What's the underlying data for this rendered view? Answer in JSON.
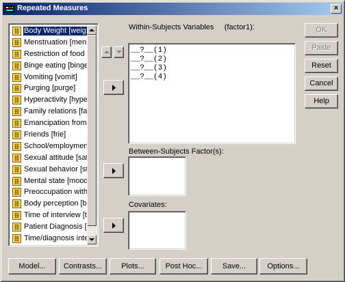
{
  "window": {
    "title": "Repeated Measures",
    "close_glyph": "×"
  },
  "variables": [
    {
      "label": "Body Weight [weig",
      "icon": "scale-variable-icon",
      "selected": true
    },
    {
      "label": "Menstruation [mens",
      "icon": "scale-variable-icon"
    },
    {
      "label": "Restriction of food i",
      "icon": "scale-variable-icon"
    },
    {
      "label": "Binge eating [binge",
      "icon": "scale-variable-icon"
    },
    {
      "label": "Vomiting [vomit]",
      "icon": "scale-variable-icon"
    },
    {
      "label": "Purging [purge]",
      "icon": "scale-variable-icon"
    },
    {
      "label": "Hyperactivity [hype",
      "icon": "scale-variable-icon"
    },
    {
      "label": "Family relations [fan",
      "icon": "scale-variable-icon"
    },
    {
      "label": "Emancipation from",
      "icon": "scale-variable-icon"
    },
    {
      "label": "Friends [frie]",
      "icon": "scale-variable-icon"
    },
    {
      "label": "School/employmen",
      "icon": "scale-variable-icon"
    },
    {
      "label": "Sexual attitude [sat",
      "icon": "scale-variable-icon"
    },
    {
      "label": "Sexual behavior [st",
      "icon": "scale-variable-icon"
    },
    {
      "label": "Mental state [mood",
      "icon": "scale-variable-icon"
    },
    {
      "label": "Preoccupation with",
      "icon": "scale-variable-icon"
    },
    {
      "label": "Body perception [bo",
      "icon": "scale-variable-icon"
    },
    {
      "label": "Time of interview [ti",
      "icon": "scale-variable-icon"
    },
    {
      "label": "Patient Diagnosis [d",
      "icon": "scale-variable-icon"
    },
    {
      "label": "Time/diagnosis inte",
      "icon": "scale-variable-icon"
    }
  ],
  "within": {
    "label_prefix": "Within-Subjects Variables",
    "factor": "(factor1):",
    "rows": [
      "__?__(1)",
      "__?__(2)",
      "__?__(3)",
      "__?__(4)"
    ]
  },
  "between": {
    "label": "Between-Subjects Factor(s):"
  },
  "covariates": {
    "label": "Covariates:"
  },
  "side_buttons": {
    "ok": "OK",
    "paste": "Paste",
    "reset": "Reset",
    "cancel": "Cancel",
    "help": "Help"
  },
  "bottom_buttons": {
    "model": "Model...",
    "contrasts": "Contrasts...",
    "plots": "Plots...",
    "post_hoc": "Post Hoc...",
    "save": "Save...",
    "options": "Options..."
  }
}
